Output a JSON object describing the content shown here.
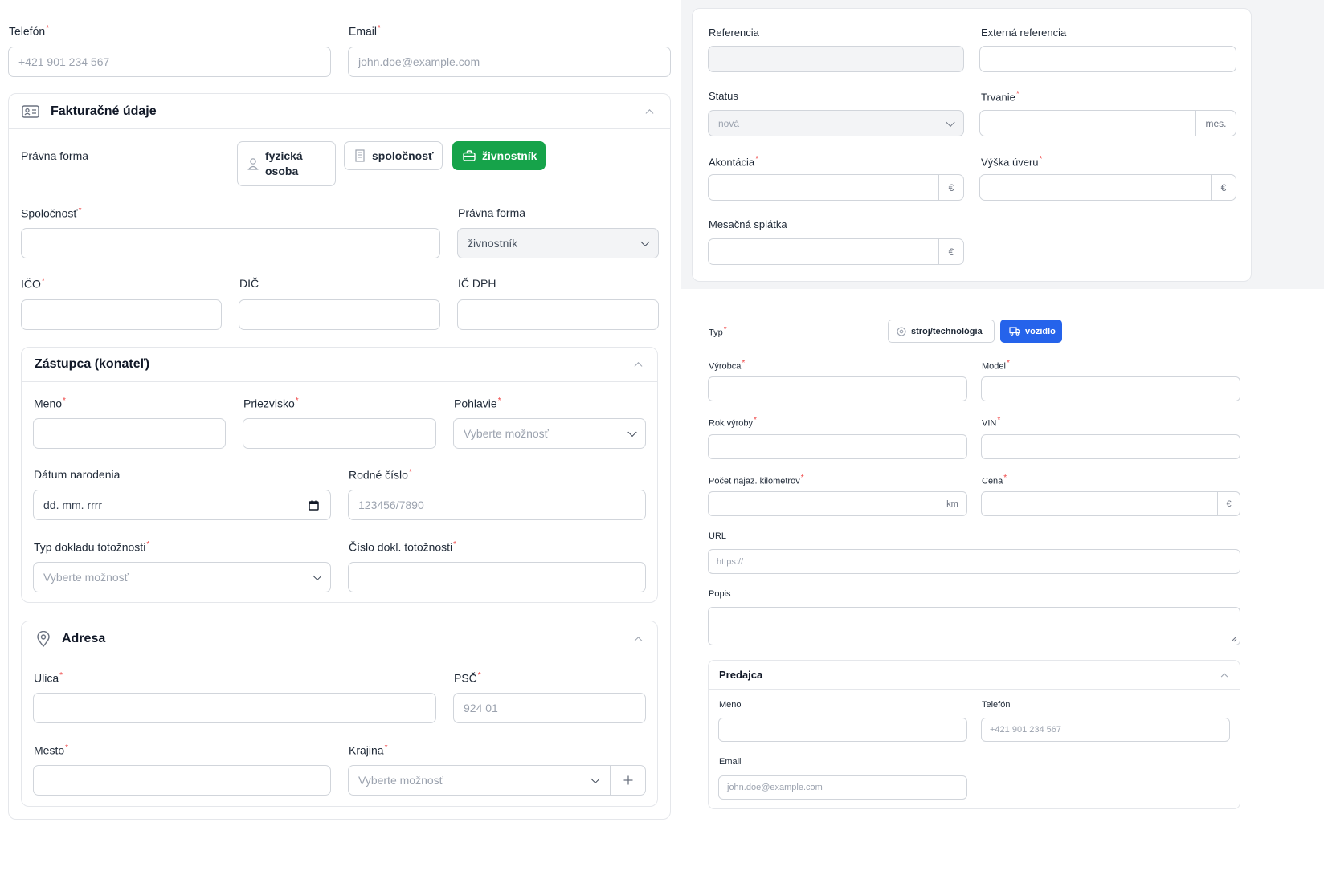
{
  "left": {
    "contact": {
      "phone_label": "Telefón",
      "phone_placeholder": "+421 901 234 567",
      "email_label": "Email",
      "email_placeholder": "john.doe@example.com"
    },
    "billing": {
      "title": "Fakturačné údaje",
      "legal_form_label": "Právna forma",
      "legal_form_options": [
        {
          "line1": "fyzická",
          "line2": "osoba"
        },
        {
          "line1": "spoločnosť",
          "line2": ""
        },
        {
          "line1": "živnostník",
          "line2": ""
        }
      ],
      "selected_legal_form": "živnostník",
      "company_label": "Spoločnosť",
      "legal_form_select_label": "Právna forma",
      "legal_form_select_value": "živnostník",
      "ico_label": "IČO",
      "dic_label": "DIČ",
      "ic_dph_label": "IČ DPH"
    },
    "representative": {
      "title": "Zástupca (konateľ)",
      "first_name_label": "Meno",
      "last_name_label": "Priezvisko",
      "gender_label": "Pohlavie",
      "gender_placeholder": "Vyberte možnosť",
      "birth_date_label": "Dátum narodenia",
      "birth_date_placeholder": "dd. mm. rrrr",
      "birth_number_label": "Rodné číslo",
      "birth_number_placeholder": "123456/7890",
      "id_type_label": "Typ dokladu totožnosti",
      "id_type_placeholder": "Vyberte možnosť",
      "id_number_label": "Číslo dokl. totožnosti"
    },
    "address": {
      "title": "Adresa",
      "street_label": "Ulica",
      "zip_label": "PSČ",
      "zip_placeholder": "924 01",
      "city_label": "Mesto",
      "country_label": "Krajina",
      "country_placeholder": "Vyberte možnosť"
    }
  },
  "right": {
    "deal": {
      "reference_label": "Referencia",
      "external_reference_label": "Externá referencia",
      "status_label": "Status",
      "status_value": "nová",
      "duration_label": "Trvanie",
      "duration_suffix": "mes.",
      "down_payment_label": "Akontácia",
      "down_payment_suffix": "€",
      "loan_amount_label": "Výška úveru",
      "loan_amount_suffix": "€",
      "monthly_payment_label": "Mesačná splátka",
      "monthly_payment_suffix": "€"
    },
    "subject": {
      "type_label": "Typ",
      "type_options": [
        "stroj/technológia",
        "vozidlo"
      ],
      "selected_type": "vozidlo",
      "manufacturer_label": "Výrobca",
      "model_label": "Model",
      "year_label": "Rok výroby",
      "vin_label": "VIN",
      "mileage_label": "Počet najaz. kilometrov",
      "mileage_suffix": "km",
      "price_label": "Cena",
      "price_suffix": "€",
      "url_label": "URL",
      "url_placeholder": "https://",
      "description_label": "Popis"
    },
    "seller": {
      "title": "Predajca",
      "name_label": "Meno",
      "phone_label": "Telefón",
      "phone_placeholder": "+421 901 234 567",
      "email_label": "Email",
      "email_placeholder": "john.doe@example.com"
    }
  },
  "colors": {
    "green": "#16a34a",
    "blue": "#2563eb",
    "required": "#ef4444",
    "border": "#d1d5db"
  }
}
